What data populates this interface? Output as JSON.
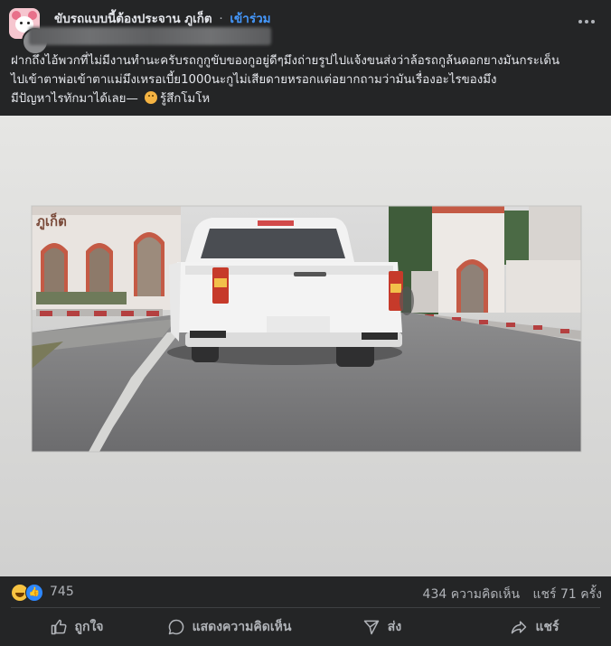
{
  "header": {
    "group_name": "ขับรถแบบนี้ต้องประจาน ภูเก็ต",
    "separator": "·",
    "join_label": "เข้าร่วม"
  },
  "post": {
    "line1": "ฝากถึงไอ้พวกที่ไม่มีงานทำนะครับรถกูกูขับของกูอยู่ดีๆมึงถ่ายรูปไปแจ้งขนส่งว่าล้อรถกูล้นดอกยางมันกระเด็น",
    "line2": "ไปเข้าตาพ่อเข้าตาแม่มึงเหรอเบี้ย1000นะกูไม่เสียดายหรอกแต่อยากถามว่ามันเรื่องอะไรของมึง",
    "line3_text": "มีปัญหาไรทักมาได้เลย—",
    "feeling": "รู้สึกโมโห"
  },
  "photo": {
    "sign_text": "ภูเก็ต"
  },
  "stats": {
    "reactions": "745",
    "comments": "434 ความคิดเห็น",
    "shares": "แชร์ 71 ครั้ง"
  },
  "actions": {
    "like": "ถูกใจ",
    "comment": "แสดงความคิดเห็น",
    "send": "ส่ง",
    "share": "แชร์"
  },
  "icons": {
    "more": "more-options-icon",
    "like": "thumbs-up-icon",
    "comment": "comment-bubble-icon",
    "send": "send-icon",
    "share": "share-arrow-icon"
  }
}
